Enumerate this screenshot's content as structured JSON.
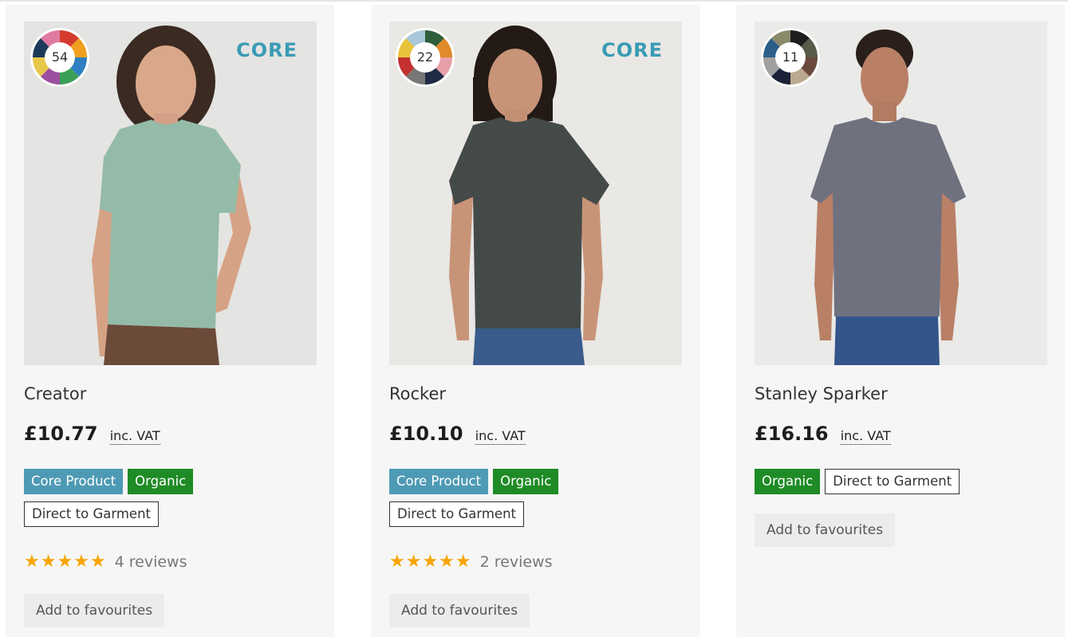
{
  "products": [
    {
      "name": "Creator",
      "price": "£10.77",
      "vat_label": "inc. VAT",
      "colour_count": "54",
      "brand_logo": "CORE",
      "badges": {
        "core": "Core Product",
        "organic": "Organic",
        "dtg": "Direct to Garment"
      },
      "stars": "★★★★★",
      "reviews": "4 reviews",
      "favourite_label": "Add to favourites",
      "shirt_color": "#94bba8",
      "image_bg": "#e2e2e0"
    },
    {
      "name": "Rocker",
      "price": "£10.10",
      "vat_label": "inc. VAT",
      "colour_count": "22",
      "brand_logo": "CORE",
      "badges": {
        "core": "Core Product",
        "organic": "Organic",
        "dtg": "Direct to Garment"
      },
      "stars": "★★★★★",
      "reviews": "2 reviews",
      "favourite_label": "Add to favourites",
      "shirt_color": "#444a48",
      "image_bg": "#e8e7e3"
    },
    {
      "name": "Stanley Sparker",
      "price": "£16.16",
      "vat_label": "inc. VAT",
      "colour_count": "11",
      "badges": {
        "organic": "Organic",
        "dtg": "Direct to Garment"
      },
      "favourite_label": "Add to favourites",
      "shirt_color": "#6f717f",
      "image_bg": "#e9e9e7"
    }
  ],
  "colors": {
    "core_badge": "#4e9ab5",
    "organic_badge": "#1f8b26",
    "star": "#f7a500",
    "core_logo": "#3a9bb5"
  },
  "icons": {
    "rating": "star-icon",
    "colour_swatch": "colour-wheel-icon"
  }
}
